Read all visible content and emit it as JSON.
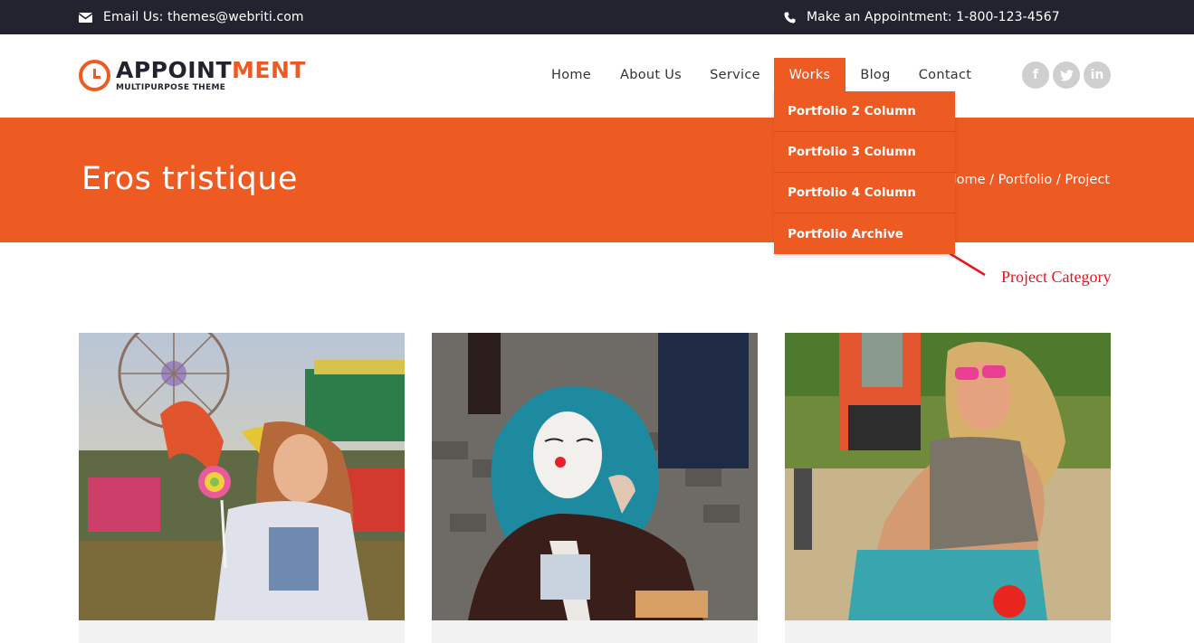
{
  "topbar": {
    "email_text": "Email Us: themes@webriti.com",
    "phone_text": "Make an Appointment: 1-800-123-4567"
  },
  "logo": {
    "brand_main": "Appoint",
    "brand_accent": "ment",
    "tagline": "MULTIPURPOSE THEME"
  },
  "nav": {
    "items": [
      {
        "label": "Home"
      },
      {
        "label": "About Us"
      },
      {
        "label": "Service"
      },
      {
        "label": "Works",
        "active": true
      },
      {
        "label": "Blog"
      },
      {
        "label": "Contact"
      }
    ]
  },
  "social": {
    "icons": [
      "facebook-icon",
      "twitter-icon",
      "linkedin-icon"
    ],
    "labels": [
      "f",
      "t",
      "in"
    ]
  },
  "dropdown": {
    "items": [
      {
        "label": "Portfolio 2 Column"
      },
      {
        "label": "Portfolio 3 Column"
      },
      {
        "label": "Portfolio 4 Column"
      },
      {
        "label": "Portfolio Archive"
      }
    ]
  },
  "banner": {
    "title": "Eros tristique",
    "breadcrumb": "Home   /  Portfolio / Project"
  },
  "annotation": {
    "label": "Project Category"
  },
  "colors": {
    "accent": "#ee5b22",
    "topbar": "#23232f",
    "annotation": "#e8141c"
  }
}
